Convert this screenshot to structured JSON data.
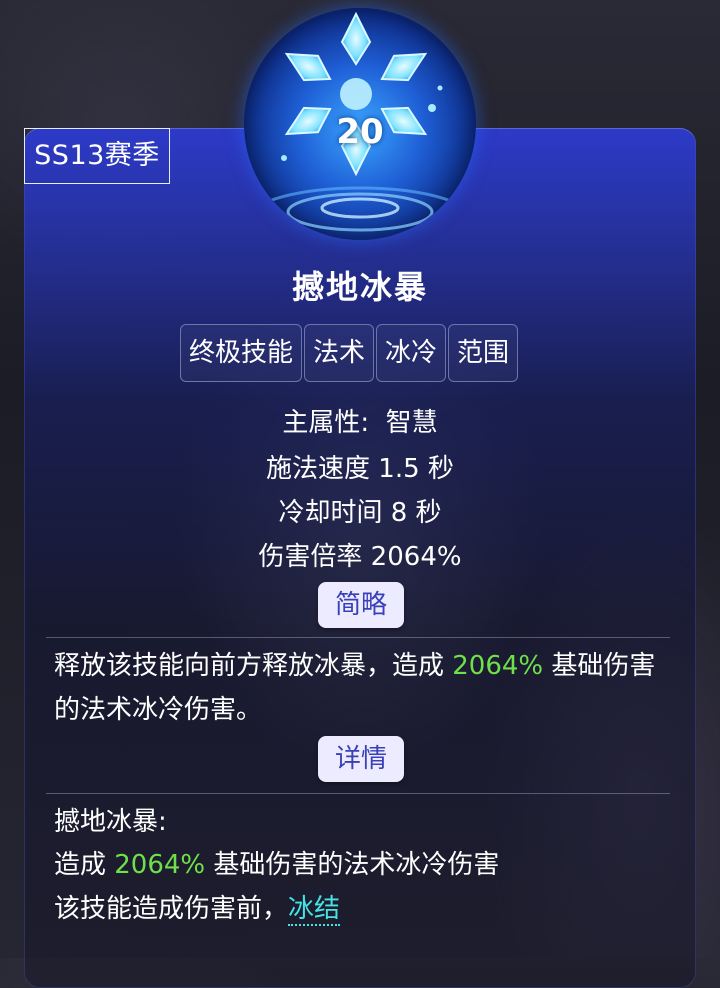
{
  "season_label": "SS13赛季",
  "skill": {
    "level": "20",
    "name": "撼地冰暴",
    "tags": [
      "终极技能",
      "法术",
      "冰冷",
      "范围"
    ]
  },
  "stats": {
    "main_attr": "主属性:  智慧",
    "cast_speed": "施法速度 1.5 秒",
    "cooldown": "冷却时间 8 秒",
    "damage_mult": "伤害倍率 2064%"
  },
  "summary": {
    "button_label": "简略",
    "text_before": "释放该技能向前方释放冰暴，造成 ",
    "highlight": "2064%",
    "text_after": " 基础伤害的法术冰冷伤害。"
  },
  "details": {
    "button_label": "详情",
    "heading": "撼地冰暴:",
    "line2_before": "造成 ",
    "line2_highlight": "2064%",
    "line2_after": " 基础伤害的法术冰冷伤害",
    "line3_before": "该技能造成伤害前，",
    "line3_link": "冰结"
  },
  "colors": {
    "highlight": "#6fe04a",
    "link": "#46e3e6",
    "button_bg": "#ecebff"
  }
}
